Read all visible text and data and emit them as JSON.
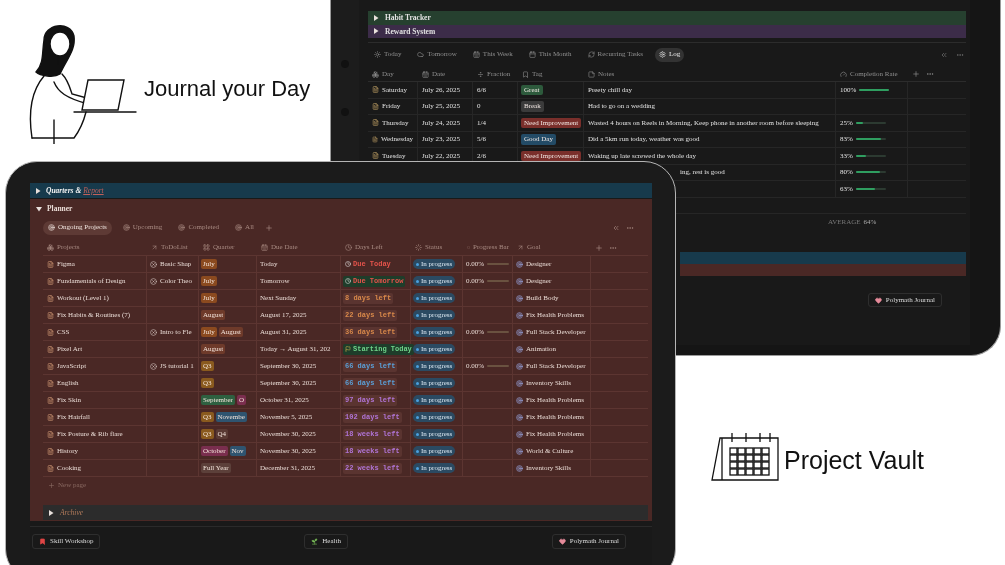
{
  "promo": {
    "headline_top": "Journal your Day",
    "headline_bottom": "Project Vault"
  },
  "journal": {
    "sections": [
      {
        "title": "Habit Tracker",
        "color": "#26402f",
        "expanded": false
      },
      {
        "title": "Reward System",
        "color": "#3c2c49",
        "expanded": false
      }
    ],
    "tabs": [
      {
        "label": "Today",
        "selected": false
      },
      {
        "label": "Tomorrow",
        "selected": false
      },
      {
        "label": "This Week",
        "selected": false
      },
      {
        "label": "This Month",
        "selected": false
      },
      {
        "label": "Recurring Tasks",
        "selected": false
      },
      {
        "label": "Log",
        "selected": true
      }
    ],
    "columns": [
      "Day",
      "Date",
      "Fraction",
      "Tag",
      "Notes",
      "Completion Rate"
    ],
    "rows": [
      {
        "kind": "full",
        "day": "Saturday",
        "date": "July 26, 2025",
        "fraction": "6/6",
        "tag": {
          "label": "Great",
          "color": "#2d5a3c"
        },
        "notes": "Preety chill day",
        "rate": "100%",
        "level": 1
      },
      {
        "kind": "full",
        "day": "Friday",
        "date": "July 25, 2025",
        "fraction": "0",
        "tag": {
          "label": "Break",
          "color": "#3b3b3b"
        },
        "notes": "Had to go on a wedding"
      },
      {
        "kind": "full",
        "day": "Thursday",
        "date": "July 24, 2025",
        "fraction": "1/4",
        "tag": {
          "label": "Need Improvement",
          "color": "#7a2f2b"
        },
        "notes": "Wasted 4 hours on Reels in Morning, Keep phone in another room before sleeping",
        "rate": "25%",
        "level": 0.25
      },
      {
        "kind": "full",
        "day": "Wednesday",
        "date": "July 23, 2025",
        "fraction": "5/6",
        "tag": {
          "label": "Good Day",
          "color": "#234b66"
        },
        "notes": "Did a 5km run today, weather was good",
        "rate": "83%",
        "level": 0.83
      },
      {
        "kind": "full",
        "day": "Tuesday",
        "date": "July 22, 2025",
        "fraction": "2/6",
        "tag": {
          "label": "Need Improvement",
          "color": "#7a2f2b"
        },
        "notes": "Waking up late screwed the whole day",
        "rate": "33%",
        "level": 0.33
      },
      {
        "kind": "covered",
        "notes": "ing, rest is good",
        "rate": "80%",
        "level": 0.8
      },
      {
        "kind": "covered",
        "rate": "63%",
        "level": 0.63
      }
    ],
    "average": {
      "label": "AVERAGE",
      "value": "64%"
    },
    "collapsed_bars": [
      {
        "color": "#173a4c"
      },
      {
        "color": "#4a2825"
      }
    ],
    "footer_button": "Polymath Journal"
  },
  "planner_screen": {
    "quarters": {
      "title": "Quarters &",
      "link": "Report",
      "expanded": false
    },
    "planner": {
      "title": "Planner",
      "expanded": true,
      "tabs": [
        {
          "label": "Ongoing Projects",
          "selected": true
        },
        {
          "label": "Upcoming",
          "selected": false
        },
        {
          "label": "Completed",
          "selected": false
        },
        {
          "label": "All",
          "selected": false
        }
      ],
      "columns": [
        "Projects",
        "ToDoList",
        "Quarter",
        "Due Date",
        "Days Left",
        "Status",
        "Progress Bar",
        "Goal"
      ],
      "rows": [
        {
          "project": "Figma",
          "todo": "Basic Shap",
          "quarters": [
            {
              "label": "July",
              "color": "#8b4a1f"
            }
          ],
          "due": "Today",
          "days_left": {
            "label": "Due Today",
            "kind": "due",
            "color": "#e5534b"
          },
          "status": "In progress",
          "progress": "0.00%",
          "level": 0,
          "goal": "Designer"
        },
        {
          "project": "Fundamentals of Design",
          "todo": "Color Theo",
          "quarters": [
            {
              "label": "July",
              "color": "#8b4a1f"
            }
          ],
          "due": "Tomorrow",
          "days_left": {
            "label": "Due Tomorrow",
            "kind": "due_soon",
            "color": "#1e3d2a"
          },
          "status": "In progress",
          "progress": "0.00%",
          "level": 0,
          "goal": "Designer"
        },
        {
          "project": "Workout (Level 1)",
          "quarters": [
            {
              "label": "July",
              "color": "#8b4a1f"
            }
          ],
          "due": "Next Sunday",
          "days_left": {
            "label": "8 days left",
            "kind": "count",
            "color": "#d9894a"
          },
          "status": "In progress",
          "goal": "Build Body"
        },
        {
          "project": "Fix Habits & Routines (7)",
          "quarters": [
            {
              "label": "August",
              "color": "#6e3a2a"
            }
          ],
          "due": "August 17, 2025",
          "days_left": {
            "label": "22 days left",
            "kind": "count",
            "color": "#d9894a"
          },
          "status": "In progress",
          "goal": "Fix Health Problems"
        },
        {
          "project": "CSS",
          "todo": "Intro to Fle",
          "quarters": [
            {
              "label": "July",
              "color": "#8b4a1f"
            },
            {
              "label": "August",
              "color": "#6e3a2a"
            }
          ],
          "due": "August 31, 2025",
          "days_left": {
            "label": "36 days left",
            "kind": "count",
            "color": "#d9894a"
          },
          "status": "In progress",
          "progress": "0.00%",
          "level": 0,
          "goal": "Full Stack Developer"
        },
        {
          "project": "Pixel Art",
          "quarters": [
            {
              "label": "August",
              "color": "#6e3a2a"
            }
          ],
          "due": "Today → August 31, 202",
          "days_left": {
            "label": "Starting Today",
            "kind": "start",
            "color": "#1e3d2a"
          },
          "status": "In progress",
          "goal": "Animation"
        },
        {
          "project": "JavaScript",
          "todo": "JS tutorial 1",
          "quarters": [
            {
              "label": "Q3",
              "color": "#8a5a1e"
            }
          ],
          "due": "September 30, 2025",
          "days_left": {
            "label": "66 days left",
            "kind": "count",
            "color": "#5aa0d8"
          },
          "status": "In progress",
          "progress": "0.00%",
          "level": 0,
          "goal": "Full Stack Developer"
        },
        {
          "project": "English",
          "quarters": [
            {
              "label": "Q3",
              "color": "#8a5a1e"
            }
          ],
          "due": "September 30, 2025",
          "days_left": {
            "label": "66 days left",
            "kind": "count",
            "color": "#5aa0d8"
          },
          "status": "In progress",
          "goal": "Inventory Skills"
        },
        {
          "project": "Fix Skin",
          "quarters": [
            {
              "label": "September",
              "color": "#2e6040"
            },
            {
              "label": "O",
              "color": "#7a2e4e"
            }
          ],
          "due": "October 31, 2025",
          "days_left": {
            "label": "97 days left",
            "kind": "count",
            "color": "#b074d6"
          },
          "status": "In progress",
          "goal": "Fix Health Problems"
        },
        {
          "project": "Fix Hairfall",
          "quarters": [
            {
              "label": "Q3",
              "color": "#8a5a1e"
            },
            {
              "label": "Novembe",
              "color": "#2f5470"
            }
          ],
          "due": "November 5, 2025",
          "days_left": {
            "label": "102 days left",
            "kind": "count",
            "color": "#b074d6"
          },
          "status": "In progress",
          "goal": "Fix Health Problems"
        },
        {
          "project": "Fix Posture & Rib flare",
          "quarters": [
            {
              "label": "Q3",
              "color": "#8a5a1e"
            },
            {
              "label": "Q4",
              "color": "#5a3a34"
            }
          ],
          "due": "November 30, 2025",
          "days_left": {
            "label": "18 weeks left",
            "kind": "count",
            "color": "#b074d6"
          },
          "status": "In progress",
          "goal": "Fix Health Problems"
        },
        {
          "project": "History",
          "quarters": [
            {
              "label": "October",
              "color": "#7a2e4e"
            },
            {
              "label": "Nov",
              "color": "#2f5470"
            }
          ],
          "due": "November 30, 2025",
          "days_left": {
            "label": "18 weeks left",
            "kind": "count",
            "color": "#b074d6"
          },
          "status": "In progress",
          "goal": "World & Culture"
        },
        {
          "project": "Cooking",
          "quarters": [
            {
              "label": "Full Year",
              "color": "#5c403a"
            }
          ],
          "due": "December 31, 2025",
          "days_left": {
            "label": "22 weeks left",
            "kind": "count",
            "color": "#b074d6"
          },
          "status": "In progress",
          "goal": "Inventory Skills"
        }
      ],
      "new_page": "New page"
    },
    "archive": {
      "title": "Archive",
      "expanded": false
    },
    "buttons": [
      "Skill Workshop",
      "Health",
      "Polymath Journal"
    ]
  }
}
